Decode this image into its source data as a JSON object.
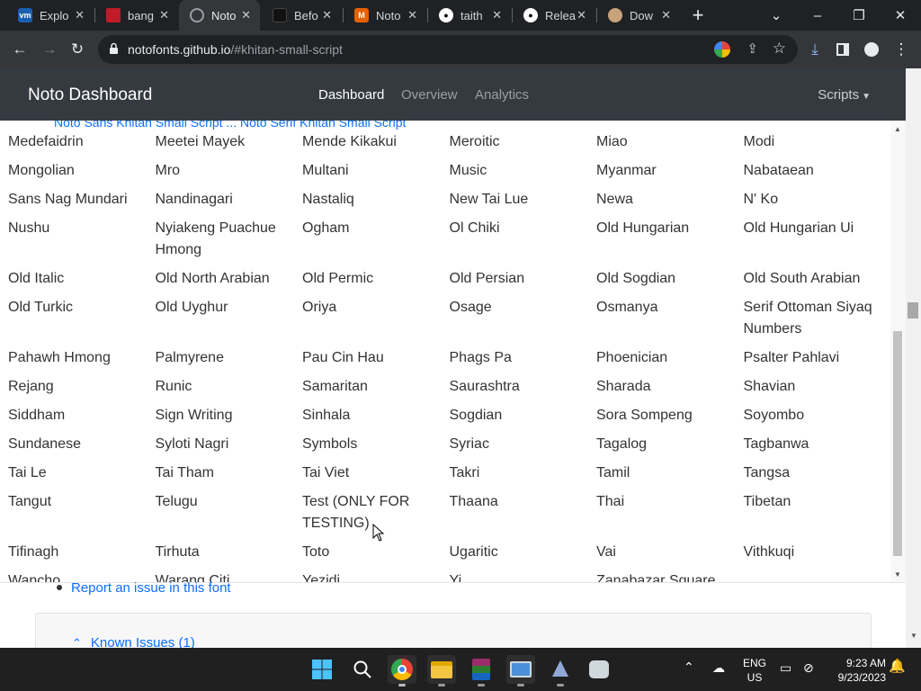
{
  "browser": {
    "tabs": [
      {
        "title": "Explo",
        "favicon": "vmware-favicon",
        "color": "#1a5fb4"
      },
      {
        "title": "bang",
        "favicon": "red-book-favicon",
        "color": "#c01c28"
      },
      {
        "title": "Noto",
        "favicon": "globe-favicon",
        "color": "#9aa0a6",
        "active": true
      },
      {
        "title": "Befo",
        "favicon": "black-bird-favicon",
        "color": "#111111"
      },
      {
        "title": "Noto",
        "favicon": "colorful-m-favicon",
        "color": "#e66100"
      },
      {
        "title": "taith",
        "favicon": "github-favicon",
        "color": "#ffffff"
      },
      {
        "title": "Relea",
        "favicon": "github-favicon",
        "color": "#ffffff"
      },
      {
        "title": "Dow",
        "favicon": "cartoon-favicon",
        "color": "#c8a27a"
      }
    ],
    "new_tab_symbol": "+",
    "address": {
      "host": "notofonts.github.io",
      "path": "/#khitan-small-script"
    }
  },
  "navbar": {
    "brand": "Noto Dashboard",
    "links": [
      "Dashboard",
      "Overview",
      "Analytics"
    ],
    "active_link": "Dashboard",
    "scripts_menu": "Scripts"
  },
  "partial_line_behind": "Noto Sans Khitan Small Script ... Noto Serif Khitan Small Script",
  "scripts": [
    "Medefaidrin",
    "Meetei Mayek",
    "Mende Kikakui",
    "Meroitic",
    "Miao",
    "Modi",
    "Mongolian",
    "Mro",
    "Multani",
    "Music",
    "Myanmar",
    "Nabataean",
    "Sans Nag Mundari",
    "Nandinagari",
    "Nastaliq",
    "New Tai Lue",
    "Newa",
    "N' Ko",
    "Nushu",
    "Nyiakeng Puachue Hmong",
    "Ogham",
    "Ol Chiki",
    "Old Hungarian",
    "Old Hungarian Ui",
    "Old Italic",
    "Old North Arabian",
    "Old Permic",
    "Old Persian",
    "Old Sogdian",
    "Old South Arabian",
    "Old Turkic",
    "Old Uyghur",
    "Oriya",
    "Osage",
    "Osmanya",
    "Serif Ottoman Siyaq Numbers",
    "Pahawh Hmong",
    "Palmyrene",
    "Pau Cin Hau",
    "Phags Pa",
    "Phoenician",
    "Psalter Pahlavi",
    "Rejang",
    "Runic",
    "Samaritan",
    "Saurashtra",
    "Sharada",
    "Shavian",
    "Siddham",
    "Sign Writing",
    "Sinhala",
    "Sogdian",
    "Sora Sompeng",
    "Soyombo",
    "Sundanese",
    "Syloti Nagri",
    "Symbols",
    "Syriac",
    "Tagalog",
    "Tagbanwa",
    "Tai Le",
    "Tai Tham",
    "Tai Viet",
    "Takri",
    "Tamil",
    "Tangsa",
    "Tangut",
    "Telugu",
    "Test (ONLY FOR TESTING)",
    "Thaana",
    "Thai",
    "Tibetan",
    "Tifinagh",
    "Tirhuta",
    "Toto",
    "Ugaritic",
    "Vai",
    "Vithkuqi",
    "Wancho",
    "Warang Citi",
    "Yezidi",
    "Yi",
    "Zanabazar Square",
    ""
  ],
  "report_link": "Report an issue in this font",
  "known_issues": "Known Issues (1)",
  "taskbar": {
    "apps": [
      "windows-start-icon",
      "search-icon",
      "chrome-icon",
      "file-explorer-icon",
      "winrar-icon",
      "remote-desktop-icon",
      "inkscape-icon",
      "app-icon"
    ],
    "lang_top": "ENG",
    "lang_bottom": "US",
    "time": "9:23 AM",
    "date": "9/23/2023"
  }
}
